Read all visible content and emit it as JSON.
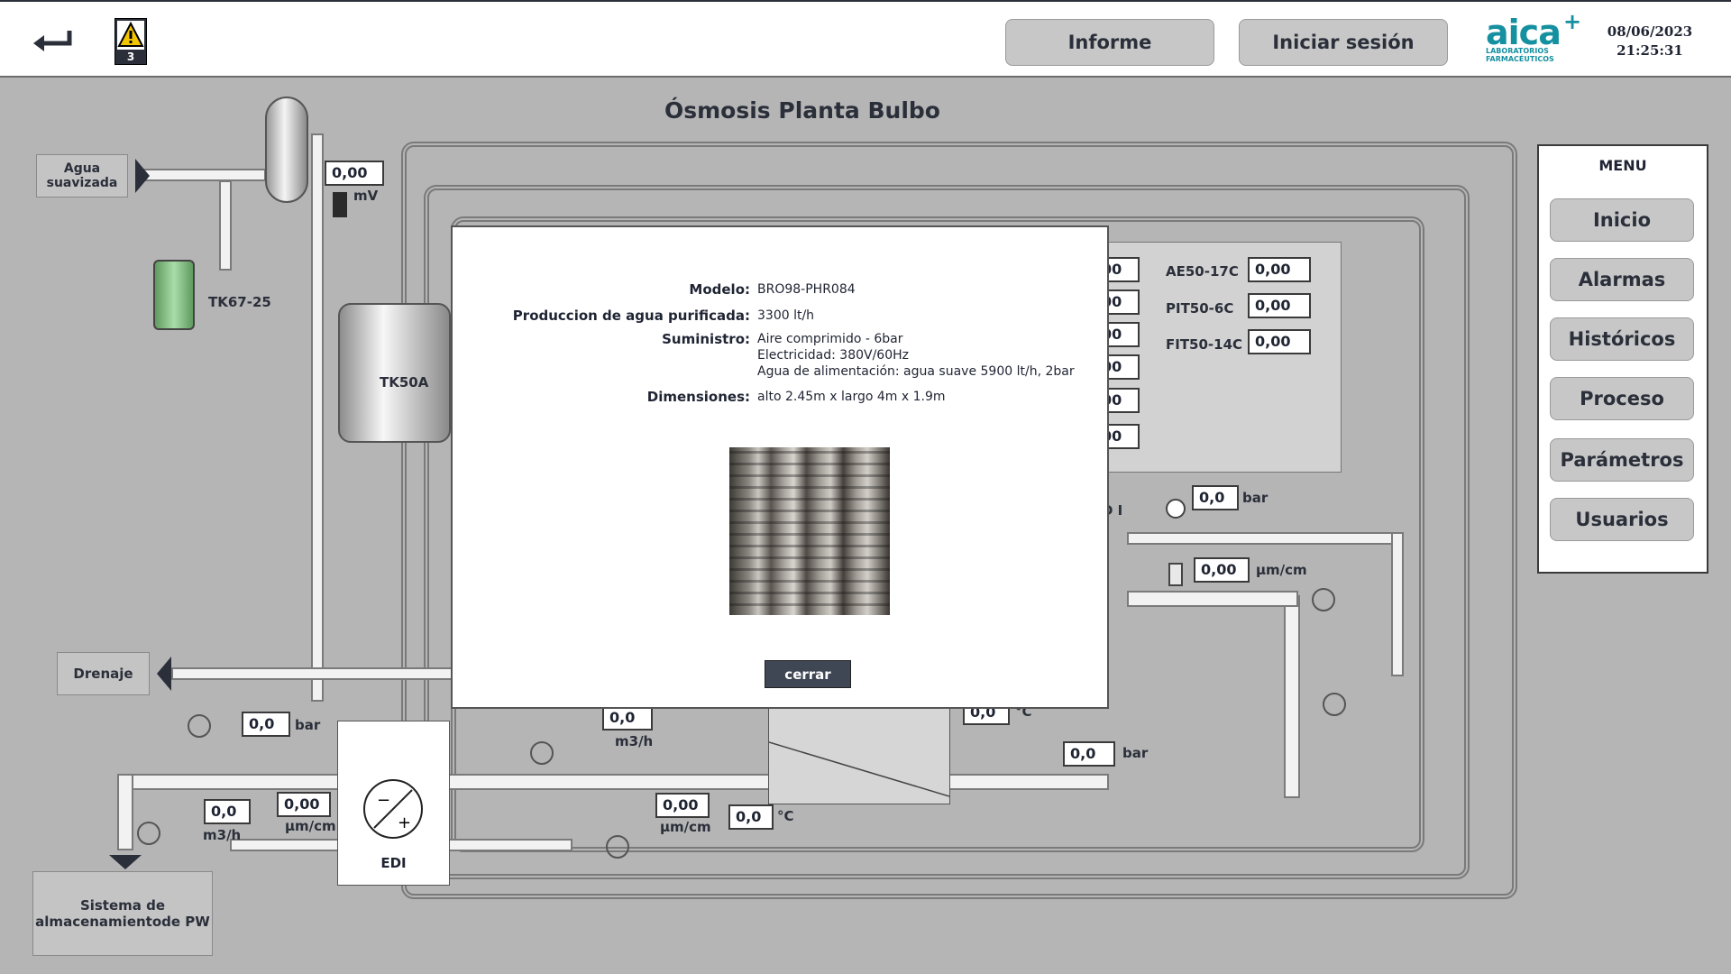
{
  "header": {
    "alarm_count": "3",
    "buttons": {
      "report": "Informe",
      "login": "Iniciar sesión"
    },
    "logo": {
      "name": "aica",
      "sub1": "LABORATORIOS",
      "sub2": "FARMACÉUTICOS"
    },
    "date": "08/06/2023",
    "time": "21:25:31"
  },
  "title": "Ósmosis Planta Bulbo",
  "boxes": {
    "soft_water": "Agua suavizada",
    "drain": "Drenaje",
    "storage": "Sistema de almacenamientode PW"
  },
  "tanks": {
    "tk67": "TK67-25",
    "tk50a": "TK50A",
    "edi": "EDI"
  },
  "values": {
    "mv": "0,00",
    "mv_unit": "mV",
    "ae": "0,00",
    "pit": "0,00",
    "fit": "0,00",
    "ae_tag": "AE50-17C",
    "pit_tag": "PIT50-6C",
    "fit_tag": "FIT50-14C",
    "left_col": [
      "00",
      "00",
      "00",
      "00",
      "00",
      "00"
    ],
    "right_bar": "0,0",
    "right_cond": "0,00",
    "bot_bar1": "0,0",
    "bot_flow1": "0,0",
    "bot_cond1": "0,00",
    "mid_flow": "0,0",
    "mid_cond": "0,00",
    "temp1": "0,0",
    "temp2": "0,0",
    "bot_bar2": "0,0"
  },
  "units": {
    "bar": "bar",
    "cond": "µm/cm",
    "flow": "m3/h",
    "temp": "°C"
  },
  "partial_label": "D I",
  "menu": {
    "title": "MENU",
    "items": [
      "Inicio",
      "Alarmas",
      "Históricos",
      "Proceso",
      "Parámetros",
      "Usuarios"
    ]
  },
  "modal": {
    "model_label": "Modelo:",
    "model": "BRO98-PHR084",
    "prod_label": "Produccion de agua purificada:",
    "prod": "3300 lt/h",
    "supply_label": "Suministro:",
    "supply1": "Aire comprimido - 6bar",
    "supply2": "Electricidad: 380V/60Hz",
    "supply3": "Agua de alimentación: agua suave 5900 lt/h, 2bar",
    "dim_label": "Dimensiones:",
    "dim": "alto 2.45m x largo 4m x 1.9m",
    "close": "cerrar"
  },
  "colors": {
    "header_bg": "#ffffff",
    "scene_bg": "#b5b5b5",
    "logo": "#1590a0",
    "close_btn": "#3f4654"
  }
}
